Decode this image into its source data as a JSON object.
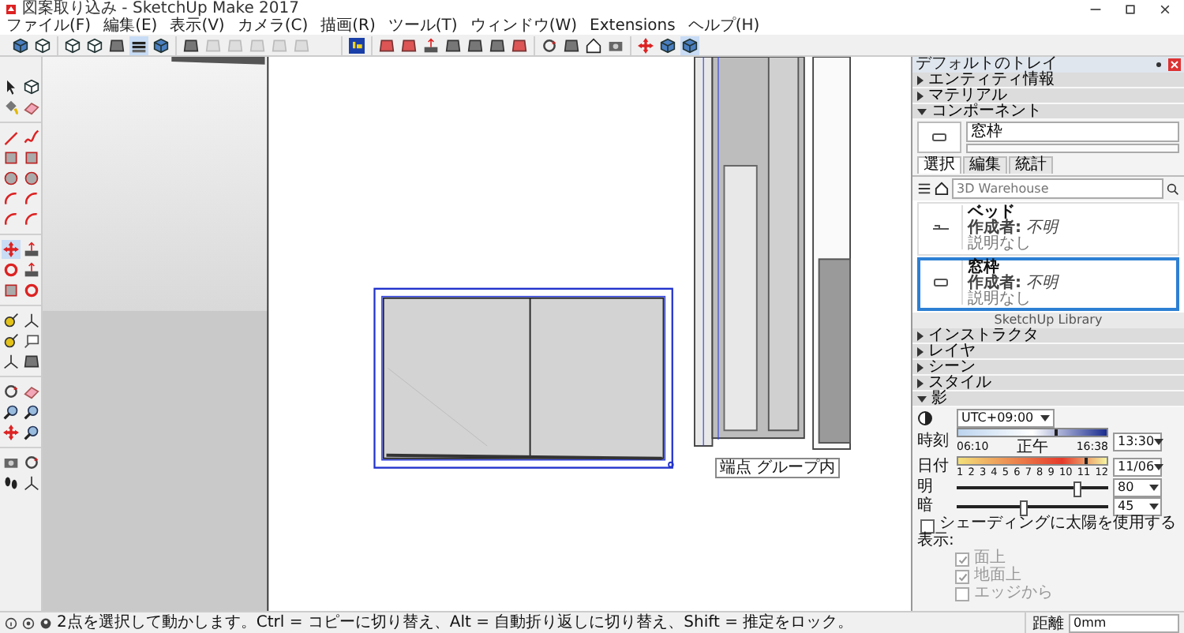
{
  "window": {
    "title": "図案取り込み - SketchUp Make 2017"
  },
  "menu": [
    "ファイル(F)",
    "編集(E)",
    "表示(V)",
    "カメラ(C)",
    "描画(R)",
    "ツール(T)",
    "ウィンドウ(W)",
    "Extensions",
    "ヘルプ(H)"
  ],
  "toolbar": {
    "groups": [
      [
        {
          "kind": "cube",
          "selected": false
        },
        {
          "kind": "box",
          "selected": false
        }
      ],
      [
        {
          "kind": "box",
          "selected": false
        },
        {
          "kind": "box",
          "selected": false
        },
        {
          "kind": "block",
          "selected": false
        },
        {
          "kind": "stack",
          "selected": true
        },
        {
          "kind": "cube",
          "selected": false
        }
      ],
      [
        {
          "kind": "block",
          "selected": false
        },
        {
          "kind": "faded",
          "selected": false
        },
        {
          "kind": "faded",
          "selected": false
        },
        {
          "kind": "faded",
          "selected": false
        },
        {
          "kind": "faded",
          "selected": false
        },
        {
          "kind": "faded",
          "selected": false
        }
      ],
      [
        {
          "kind": "logo",
          "selected": false
        }
      ],
      [
        {
          "kind": "redblock",
          "selected": false
        },
        {
          "kind": "redblock",
          "selected": false
        },
        {
          "kind": "pushpull",
          "selected": false
        },
        {
          "kind": "block",
          "selected": false
        },
        {
          "kind": "block",
          "selected": false
        },
        {
          "kind": "block",
          "selected": false
        },
        {
          "kind": "redblock",
          "selected": false
        }
      ],
      [
        {
          "kind": "orbit",
          "selected": false
        },
        {
          "kind": "block",
          "selected": false
        },
        {
          "kind": "house",
          "selected": false
        },
        {
          "kind": "camera",
          "selected": false
        }
      ],
      [
        {
          "kind": "move",
          "selected": false
        },
        {
          "kind": "cube",
          "selected": false
        },
        {
          "kind": "cube",
          "selected": true
        }
      ]
    ]
  },
  "tools": {
    "groups": [
      [
        {
          "kind": "cursor",
          "selected": false
        },
        {
          "kind": "box",
          "selected": false
        },
        {
          "kind": "bucket",
          "selected": false
        },
        {
          "kind": "eraser",
          "selected": false
        }
      ],
      [
        {
          "kind": "pencil",
          "selected": false
        },
        {
          "kind": "squiggle",
          "selected": false
        },
        {
          "kind": "square",
          "selected": false
        },
        {
          "kind": "square",
          "selected": false
        },
        {
          "kind": "circle",
          "selected": false
        },
        {
          "kind": "circle",
          "selected": false
        },
        {
          "kind": "arc",
          "selected": false
        },
        {
          "kind": "arc",
          "selected": false
        },
        {
          "kind": "arc",
          "selected": false
        },
        {
          "kind": "arc",
          "selected": false
        }
      ],
      [
        {
          "kind": "move",
          "selected": true
        },
        {
          "kind": "pushpull",
          "selected": false
        },
        {
          "kind": "rotate",
          "selected": false
        },
        {
          "kind": "pushpull",
          "selected": false
        },
        {
          "kind": "square",
          "selected": false
        },
        {
          "kind": "rotate",
          "selected": false
        }
      ],
      [
        {
          "kind": "tape",
          "selected": false
        },
        {
          "kind": "axes",
          "selected": false
        },
        {
          "kind": "tape",
          "selected": false
        },
        {
          "kind": "text",
          "selected": false
        },
        {
          "kind": "axes",
          "selected": false
        },
        {
          "kind": "block",
          "selected": false
        }
      ],
      [
        {
          "kind": "orbit",
          "selected": false
        },
        {
          "kind": "eraser",
          "selected": false
        },
        {
          "kind": "zoom",
          "selected": false
        },
        {
          "kind": "zoom",
          "selected": false
        },
        {
          "kind": "move",
          "selected": false
        },
        {
          "kind": "zoom",
          "selected": false
        }
      ],
      [
        {
          "kind": "camera",
          "selected": false
        },
        {
          "kind": "orbit",
          "selected": false
        },
        {
          "kind": "footprints",
          "selected": false
        },
        {
          "kind": "axes",
          "selected": false
        }
      ]
    ]
  },
  "tooltip": {
    "text": "端点 グループ内"
  },
  "tray": {
    "title": "デフォルトのトレイ",
    "sections": [
      {
        "label": "エンティティ情報",
        "expanded": false
      },
      {
        "label": "マテリアル",
        "expanded": false
      },
      {
        "label": "コンポーネント",
        "expanded": true
      }
    ],
    "components": {
      "name": "窓枠",
      "tabs": [
        {
          "label": "選択",
          "selected": true
        },
        {
          "label": "編集",
          "selected": false
        },
        {
          "label": "統計",
          "selected": false
        }
      ],
      "search": {
        "placeholder": "3D Warehouse"
      },
      "items": [
        {
          "title": "ベッド",
          "author": "**作成者:** *不明*",
          "description": "説明なし",
          "selected": false
        },
        {
          "title": "窓枠",
          "author": "**作成者:** *不明*",
          "description": "説明なし",
          "selected": true
        }
      ]
    }
  },
  "library": {
    "title": "SketchUp Library",
    "sections": [
      {
        "label": "インストラクタ",
        "expanded": false
      },
      {
        "label": "レイヤ",
        "expanded": false
      },
      {
        "label": "シーン",
        "expanded": false
      },
      {
        "label": "スタイル",
        "expanded": false
      },
      {
        "label": "影",
        "expanded": true
      }
    ],
    "shadows": {
      "timezone": "UTC+09:00",
      "time": {
        "label": "時刻",
        "ticks": [
          "06:10",
          "正午",
          "16:38"
        ],
        "level": 0.65,
        "value": "13:30"
      },
      "date": {
        "label": "日付",
        "ticks": [
          "1",
          "2",
          "3",
          "4",
          "5",
          "6",
          "7",
          "8",
          "9",
          "10",
          "11",
          "12"
        ],
        "level": 0.85,
        "value": "11/06"
      },
      "light": {
        "label": "明",
        "level": 0.8,
        "value": "80"
      },
      "dark": {
        "label": "暗",
        "level": 0.45,
        "value": "45"
      },
      "use_sun": {
        "label": "シェーディングに太陽を使用する",
        "checked": false
      },
      "display": {
        "label": "表示:",
        "options": [
          {
            "label": "面上",
            "checked": true,
            "disabled": true
          },
          {
            "label": "地面上",
            "checked": true,
            "disabled": true
          },
          {
            "label": "エッジから",
            "checked": false,
            "disabled": true
          }
        ]
      }
    }
  },
  "status_bar": {
    "message": "2点を選択して動かします。Ctrl = コピーに切り替え、Alt = 自動折り返しに切り替え、Shift = 推定をロック。",
    "measure_label": "距離",
    "measure_value": "0mm"
  }
}
